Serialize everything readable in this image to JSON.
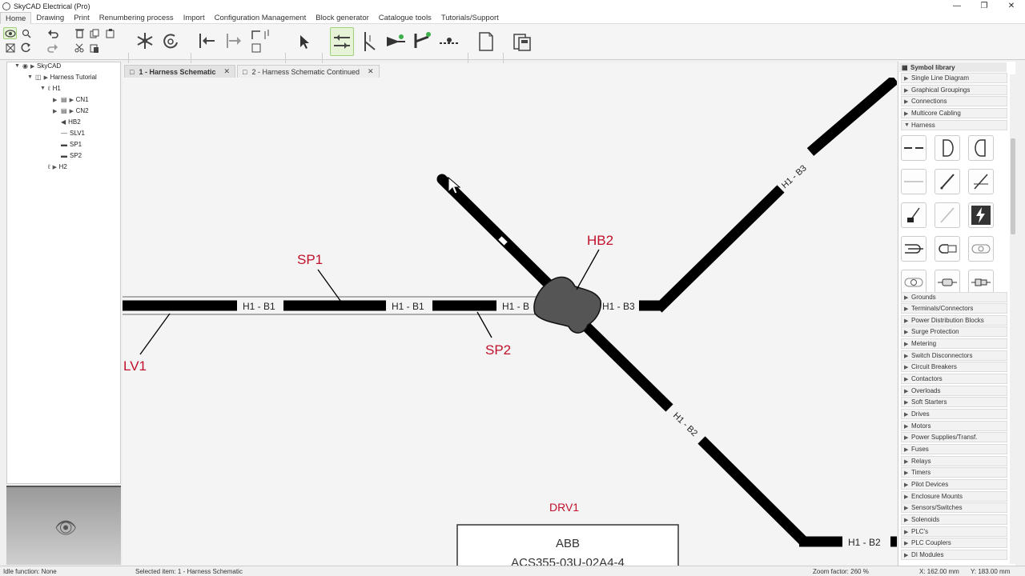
{
  "app": {
    "title": "SkyCAD Electrical (Pro)"
  },
  "menu": [
    "Home",
    "Drawing",
    "Print",
    "Renumbering process",
    "Import",
    "Configuration Management",
    "Block generator",
    "Catalogue tools",
    "Tutorials/Support"
  ],
  "tree": {
    "root": "SkyCAD",
    "project": "Harness Tutorial",
    "h1": "H1",
    "children": [
      "CN1",
      "CN2",
      "HB2",
      "SLV1",
      "SP1",
      "SP2"
    ],
    "h2": "H2"
  },
  "tabs": [
    {
      "label": "1 - Harness Schematic",
      "active": true
    },
    {
      "label": "2 - Harness Schematic Continued",
      "active": false
    }
  ],
  "canvas": {
    "labels": {
      "sp1": "SP1",
      "sp2": "SP2",
      "lv1": "LV1",
      "hb2": "HB2",
      "drv1": "DRV1",
      "b1a": "H1 - B1",
      "b1b": "H1 - B1",
      "b1c": "H1 - B",
      "b3h": "H1 - B3",
      "b3d": "H1 - B3",
      "b2d": "H1 - B2",
      "b2h": "H1 - B2",
      "abb": "ABB",
      "model": "ACS355-03U-02A4-4"
    },
    "label_color": "#c0102a"
  },
  "library": {
    "title": "Symbol library",
    "top_items": [
      "Single Line Diagram",
      "Graphical Groupings",
      "Connections",
      "Multicore Cabling"
    ],
    "open_item": "Harness",
    "items": [
      "Grounds",
      "Terminals/Connectors",
      "Power Distribution Blocks",
      "Surge Protection",
      "Metering",
      "Switch Disconnectors",
      "Circuit Breakers",
      "Contactors",
      "Overloads",
      "Soft Starters",
      "Drives",
      "Motors",
      "Power Supplies/Transf.",
      "Fuses",
      "Relays",
      "Timers",
      "Pilot Devices",
      "Enclosure Mounts",
      "Sensors/Switches",
      "Solenoids",
      "PLC's",
      "PLC Couplers",
      "DI Modules"
    ]
  },
  "status": {
    "idle": "Idle function: None",
    "selected": "Selected item: 1 - Harness Schematic",
    "zoom": "Zoom factor: 260 %",
    "x": "X: 162.00 mm",
    "y": "Y: 183.00 mm"
  }
}
